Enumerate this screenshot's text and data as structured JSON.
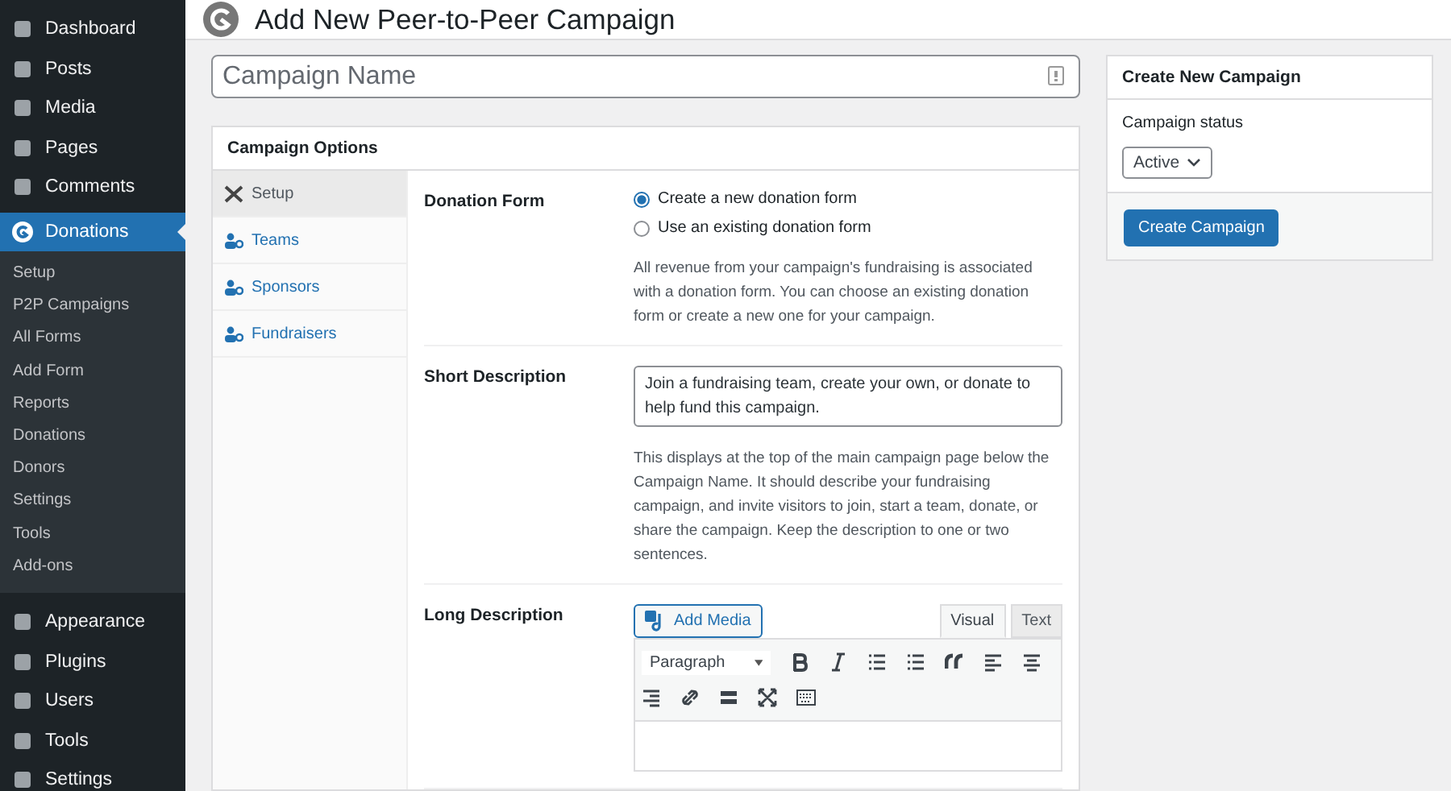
{
  "sidebar": {
    "items": [
      {
        "label": "Dashboard",
        "selected": false
      },
      {
        "label": "Posts",
        "selected": false
      },
      {
        "label": "Media",
        "selected": false
      },
      {
        "label": "Pages",
        "selected": false
      },
      {
        "label": "Comments",
        "selected": false
      },
      {
        "label": "Donations",
        "selected": true,
        "children": [
          {
            "label": "Setup",
            "selected": false
          },
          {
            "label": "P2P Campaigns",
            "selected": false
          },
          {
            "label": "All Forms",
            "selected": false
          },
          {
            "label": "Add Form",
            "selected": false
          },
          {
            "label": "Reports",
            "selected": false
          },
          {
            "label": "Donations",
            "selected": false
          },
          {
            "label": "Donors",
            "selected": false
          },
          {
            "label": "Settings",
            "selected": false
          },
          {
            "label": "Tools",
            "selected": false
          },
          {
            "label": "Add-ons",
            "selected": false
          }
        ]
      },
      {
        "label": "Appearance",
        "selected": false
      },
      {
        "label": "Plugins",
        "selected": false
      },
      {
        "label": "Users",
        "selected": false
      },
      {
        "label": "Tools",
        "selected": false
      },
      {
        "label": "Settings",
        "selected": false
      }
    ]
  },
  "page_title": "Add New Peer-to-Peer Campaign",
  "campaign_name": {
    "placeholder": "Campaign Name"
  },
  "options": {
    "title": "Campaign Options",
    "tabs": [
      {
        "label": "Setup",
        "selected": true
      },
      {
        "label": "Teams",
        "selected": false
      },
      {
        "label": "Sponsors",
        "selected": false
      },
      {
        "label": "Fundraisers",
        "selected": false
      }
    ],
    "donation_form": {
      "label": "Donation Form",
      "choices": [
        {
          "label": "Create a new donation form",
          "selected": true
        },
        {
          "label": "Use an existing donation form",
          "selected": false
        }
      ],
      "help": "All revenue from your campaign's fundraising is associated with a donation form. You can choose an existing donation form or create a new one for your campaign."
    },
    "short_description": {
      "label": "Short Description",
      "value": "Join a fundraising team, create your own, or donate to help fund this campaign.",
      "help": "This displays at the top of the main campaign page below the Campaign Name. It should describe your fundraising campaign, and invite visitors to join, start a team, donate, or share the campaign. Keep the description to one or two sentences."
    },
    "long_description": {
      "label": "Long Description",
      "add_media": "Add Media",
      "editor_tabs": [
        {
          "label": "Visual",
          "selected": true
        },
        {
          "label": "Text",
          "selected": false
        }
      ],
      "format": "Paragraph"
    }
  },
  "create_box": {
    "title": "Create New Campaign",
    "status_label": "Campaign status",
    "status_value": "Active",
    "button": "Create Campaign"
  }
}
